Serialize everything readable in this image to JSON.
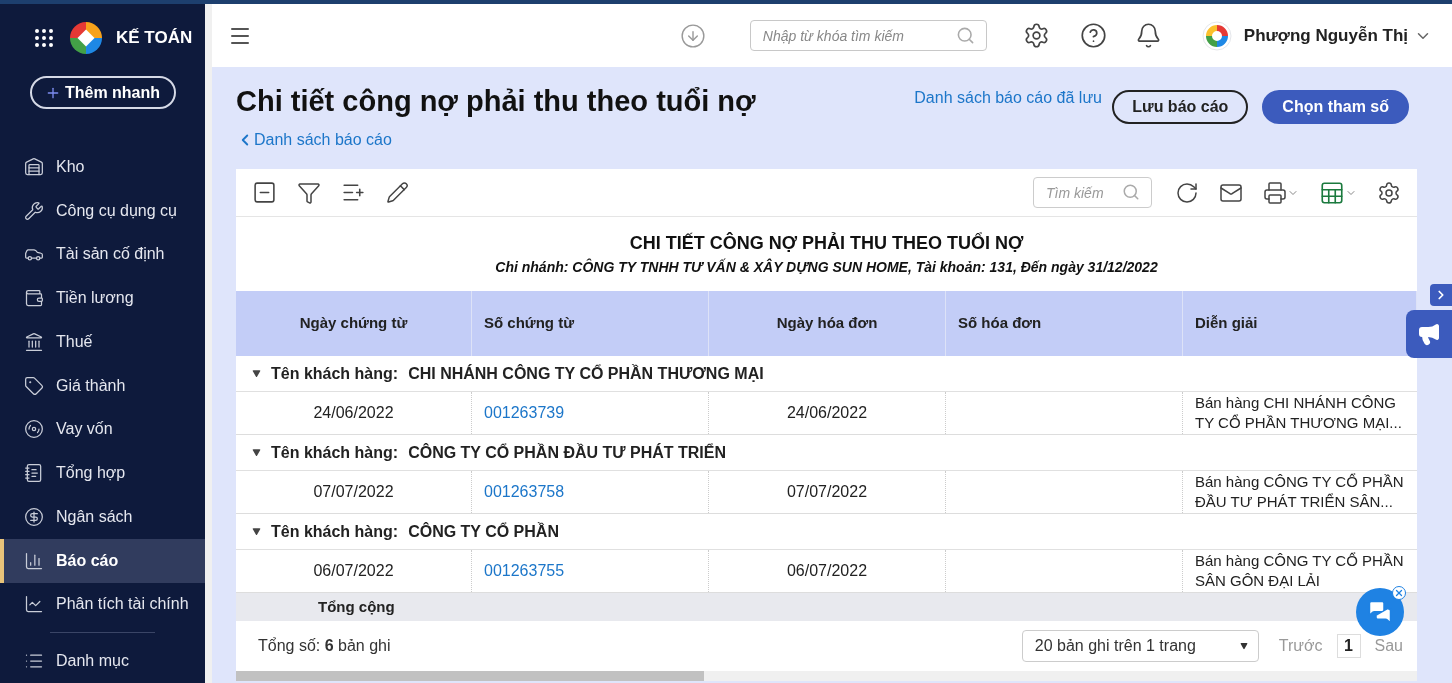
{
  "app": {
    "title": "KẾ TOÁN",
    "quick_add": "Thêm nhanh"
  },
  "sidebar": {
    "items": [
      {
        "label": "Kho",
        "selected": false
      },
      {
        "label": "Công cụ dụng cụ",
        "selected": false
      },
      {
        "label": "Tài sản cố định",
        "selected": false
      },
      {
        "label": "Tiền lương",
        "selected": false
      },
      {
        "label": "Thuế",
        "selected": false
      },
      {
        "label": "Giá thành",
        "selected": false
      },
      {
        "label": "Vay vốn",
        "selected": false
      },
      {
        "label": "Tổng hợp",
        "selected": false
      },
      {
        "label": "Ngân sách",
        "selected": false
      },
      {
        "label": "Báo cáo",
        "selected": true
      },
      {
        "label": "Phân tích tài chính",
        "selected": false
      }
    ],
    "footer_items": [
      {
        "label": "Danh mục",
        "selected": false
      }
    ]
  },
  "topbar": {
    "search_placeholder": "Nhập từ khóa tìm kiếm",
    "user": "Phượng Nguyễn Thị"
  },
  "page": {
    "title": "Chi tiết công nợ phải thu theo tuổi nợ",
    "back_link": "Danh sách báo cáo",
    "saved_reports_link": "Danh sách báo cáo đã lưu",
    "buttons": [
      {
        "label": "Lưu báo cáo",
        "kind": "outline"
      },
      {
        "label": "Chọn tham số",
        "kind": "primary"
      }
    ]
  },
  "toolbar": {
    "search_placeholder": "Tìm kiếm"
  },
  "report": {
    "title": "CHI TIẾT CÔNG NỢ PHẢI THU THEO TUỔI NỢ",
    "subtitle": "Chi nhánh: CÔNG TY TNHH TƯ VẤN & XÂY DỰNG SUN HOME, Tài khoản: 131, Đến ngày 31/12/2022"
  },
  "table": {
    "columns": [
      "Ngày chứng từ",
      "Số chứng từ",
      "Ngày hóa đơn",
      "Số hóa đơn",
      "Diễn giải"
    ],
    "groups": [
      {
        "label": "Tên khách hàng:",
        "name": "CHI NHÁNH CÔNG TY CỔ PHẦN THƯƠNG MẠI",
        "expanded": true,
        "rows": [
          {
            "date": "24/06/2022",
            "voucher": "001263739",
            "invoice_date": "24/06/2022",
            "description": "Bán hàng CHI NHÁNH CÔNG TY CỔ PHẦN THƯƠNG MẠI..."
          }
        ]
      },
      {
        "label": "Tên khách hàng:",
        "name": "CÔNG TY CỔ PHẦN ĐẦU TƯ PHÁT TRIỂN",
        "expanded": true,
        "rows": [
          {
            "date": "07/07/2022",
            "voucher": "001263758",
            "invoice_date": "07/07/2022",
            "description": "Bán hàng CÔNG TY CỔ PHẦN ĐẦU TƯ PHÁT TRIỂN SÂN..."
          }
        ]
      },
      {
        "label": "Tên khách hàng:",
        "name": "CÔNG TY CỔ PHẦN",
        "expanded": true,
        "rows": [
          {
            "date": "06/07/2022",
            "voucher": "001263755",
            "invoice_date": "06/07/2022",
            "description": "Bán hàng CÔNG TY CỔ PHẦN SÂN GÔN ĐẠI LẢI"
          }
        ]
      }
    ],
    "total_label": "Tổng cộng"
  },
  "footer": {
    "total": "Tổng số: **6** bản ghi",
    "page_size": "20 bản ghi trên 1 trang",
    "prev": "Trước",
    "page": "1",
    "next": "Sau"
  }
}
